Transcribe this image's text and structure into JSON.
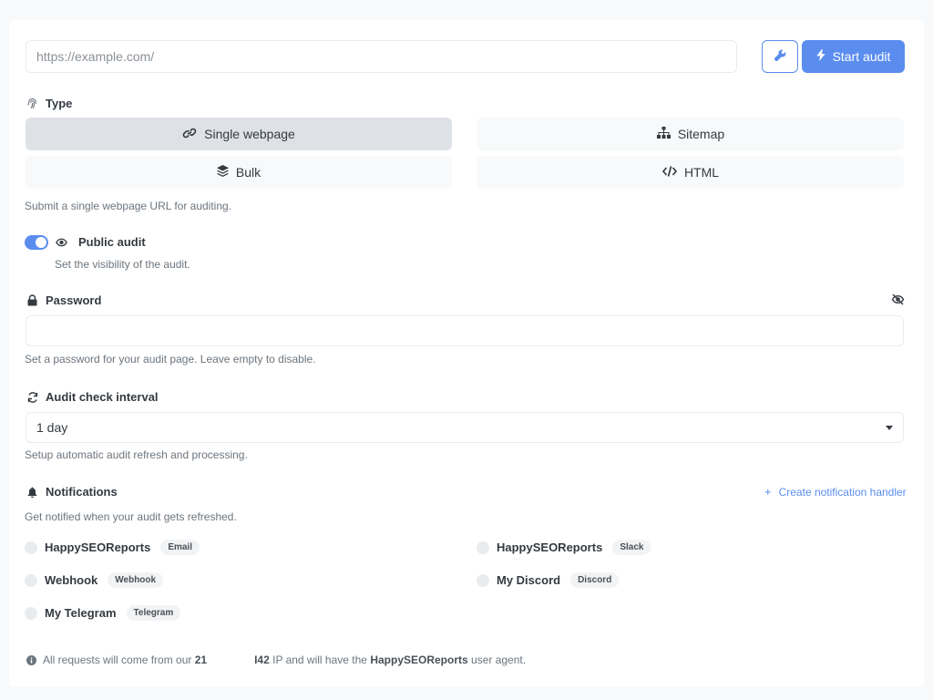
{
  "url_input": {
    "placeholder": "https://example.com/",
    "value": ""
  },
  "toolbar": {
    "start_label": "Start audit"
  },
  "type": {
    "label": "Type",
    "options": [
      {
        "label": "Single webpage",
        "icon": "link-icon",
        "active": true
      },
      {
        "label": "Sitemap",
        "icon": "sitemap-icon",
        "active": false
      },
      {
        "label": "Bulk",
        "icon": "layers-icon",
        "active": false
      },
      {
        "label": "HTML",
        "icon": "code-icon",
        "active": false
      }
    ],
    "help": "Submit a single webpage URL for auditing."
  },
  "public_audit": {
    "label": "Public audit",
    "help": "Set the visibility of the audit.",
    "enabled": true
  },
  "password": {
    "label": "Password",
    "value": "",
    "help": "Set a password for your audit page. Leave empty to disable."
  },
  "interval": {
    "label": "Audit check interval",
    "selected": "1 day",
    "help": "Setup automatic audit refresh and processing."
  },
  "notifications": {
    "label": "Notifications",
    "create_link": "Create notification handler",
    "help": "Get notified when your audit gets refreshed.",
    "handlers": [
      {
        "name": "HappySEOReports",
        "tag": "Email"
      },
      {
        "name": "HappySEOReports",
        "tag": "Slack"
      },
      {
        "name": "Webhook",
        "tag": "Webhook"
      },
      {
        "name": "My Discord",
        "tag": "Discord"
      },
      {
        "name": "My Telegram",
        "tag": "Telegram"
      }
    ]
  },
  "footer": {
    "text_1": "All requests will come from our",
    "ip_part_1": "21",
    "ip_part_2": "I42",
    "text_2": "IP and will have the",
    "agent": "HappySEOReports",
    "text_3": "user agent."
  },
  "colors": {
    "accent": "#5b8def",
    "active_type_bg": "#dee2e6",
    "muted_text": "#6c757d"
  }
}
